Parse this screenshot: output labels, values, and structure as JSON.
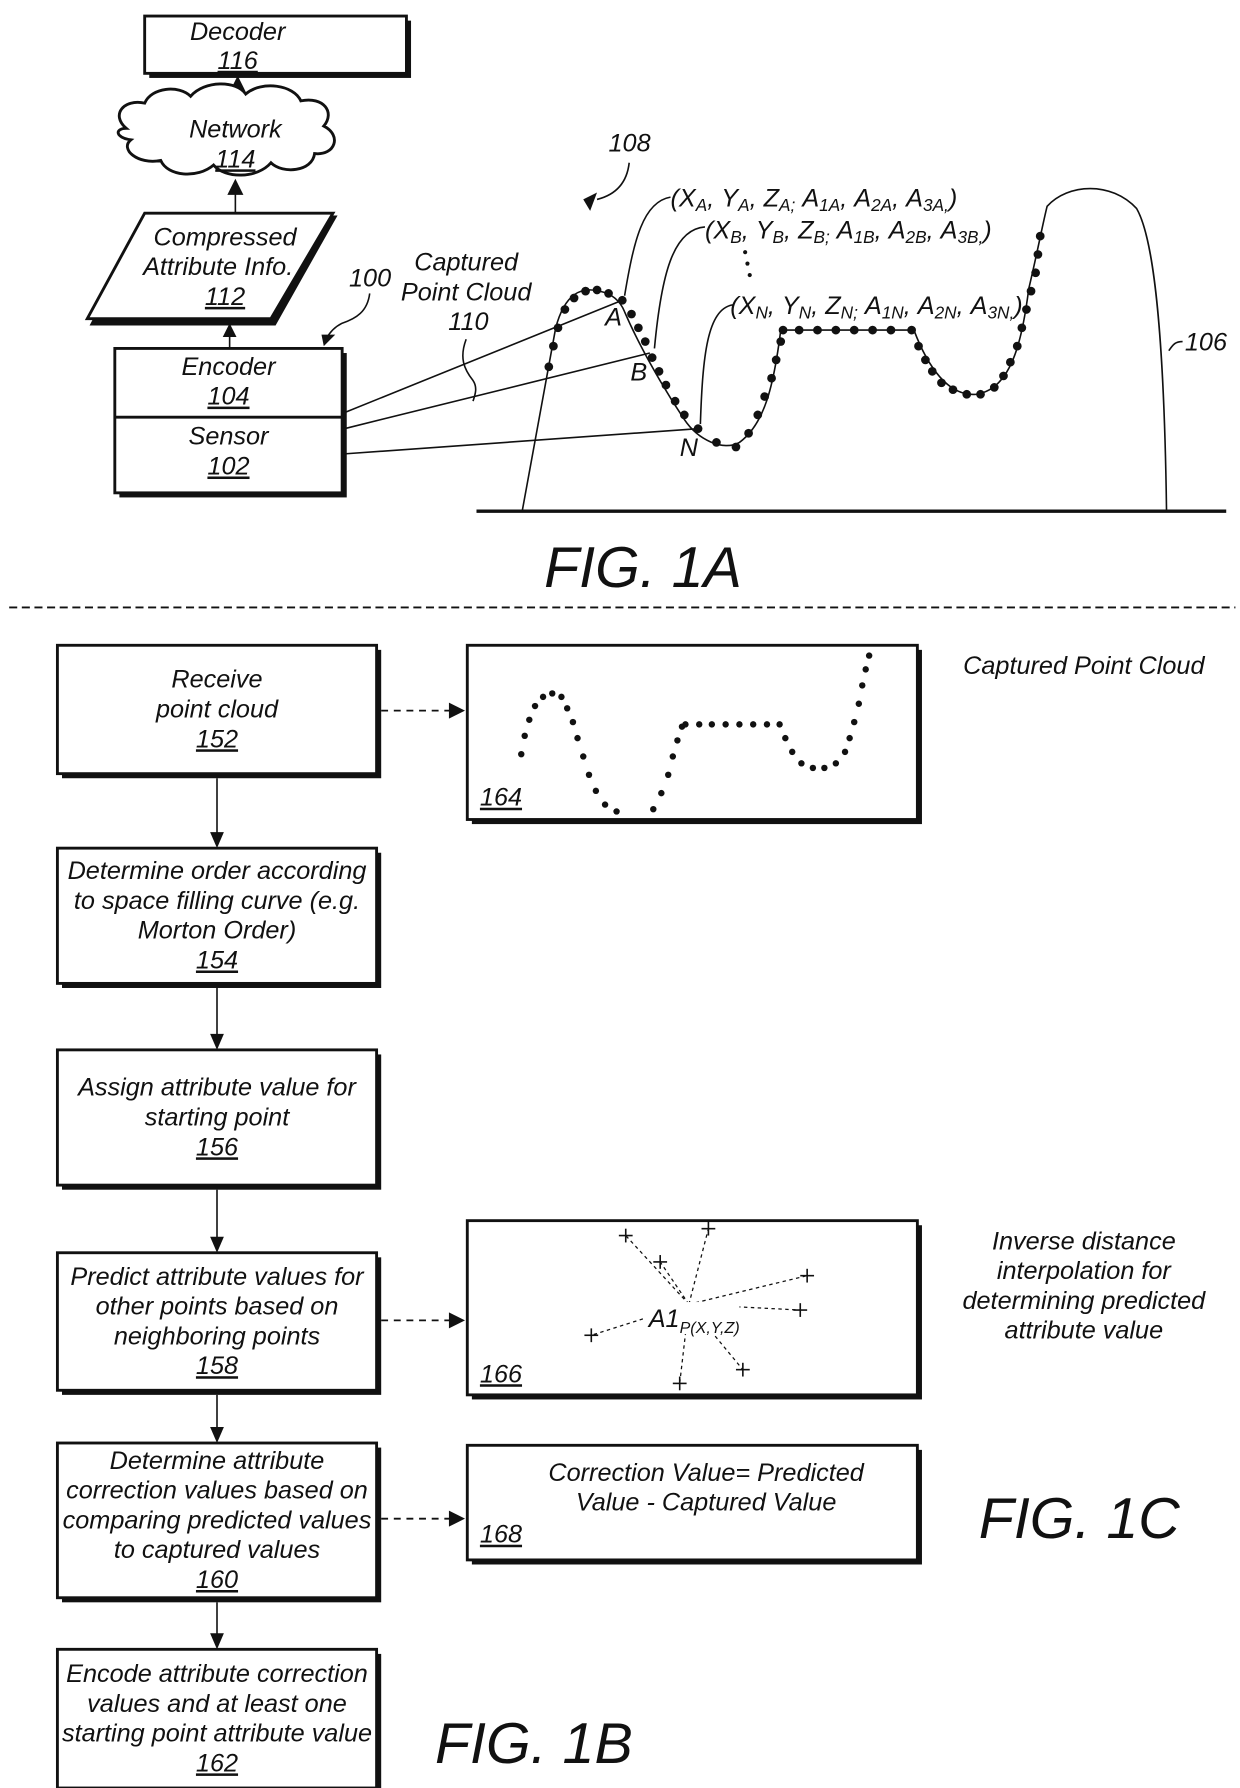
{
  "fig1a": {
    "caption": "FIG. 1A",
    "decoder": {
      "label": "Decoder",
      "ref": "116"
    },
    "network": {
      "label": "Network",
      "ref": "114"
    },
    "compressed": {
      "line1": "Compressed",
      "line2": "Attribute Info.",
      "ref": "112"
    },
    "system_ref": "100",
    "encoder": {
      "label": "Encoder",
      "ref": "104"
    },
    "sensor": {
      "label": "Sensor",
      "ref": "102"
    },
    "captured": {
      "line1": "Captured",
      "line2": "Point Cloud",
      "ref": "110"
    },
    "scene_ref": "108",
    "object_ref": "106",
    "points": {
      "a": "A",
      "b": "B",
      "n": "N"
    },
    "tuples": {
      "a": "(XA, YA, ZA; A1A, A2A, A3A,)",
      "b": "(XB, YB, ZB; A1B, A2B, A3B,)",
      "n": "(XN, YN, ZN; A1N, A2N, A3N,)"
    },
    "tuple_parts": {
      "a": [
        [
          "X",
          "A"
        ],
        [
          "Y",
          "A"
        ],
        [
          "Z",
          "A;"
        ],
        [
          "A",
          "1A"
        ],
        [
          "A",
          "2A"
        ],
        [
          "A",
          "3A,"
        ]
      ],
      "b": [
        [
          "X",
          "B"
        ],
        [
          "Y",
          "B"
        ],
        [
          "Z",
          "B;"
        ],
        [
          "A",
          "1B"
        ],
        [
          "A",
          "2B"
        ],
        [
          "A",
          "3B,"
        ]
      ],
      "n": [
        [
          "X",
          "N"
        ],
        [
          "Y",
          "N"
        ],
        [
          "Z",
          "N;"
        ],
        [
          "A",
          "1N"
        ],
        [
          "A",
          "2N"
        ],
        [
          "A",
          "3N,"
        ]
      ]
    }
  },
  "fig1b": {
    "caption": "FIG. 1B",
    "steps": [
      {
        "lines": [
          "Receive",
          "point cloud"
        ],
        "ref": "152"
      },
      {
        "lines": [
          "Determine order according",
          "to space filling curve (e.g.",
          "Morton Order)"
        ],
        "ref": "154"
      },
      {
        "lines": [
          "Assign attribute value for",
          "starting point"
        ],
        "ref": "156"
      },
      {
        "lines": [
          "Predict attribute values for",
          "other points based on",
          "neighboring points"
        ],
        "ref": "158"
      },
      {
        "lines": [
          "Determine attribute",
          "correction values based on",
          "comparing predicted values",
          "to captured values"
        ],
        "ref": "160"
      },
      {
        "lines": [
          "Encode attribute correction",
          "values and at least one",
          "starting point attribute value"
        ],
        "ref": "162"
      }
    ]
  },
  "fig1c": {
    "caption": "FIG. 1C",
    "panels": [
      {
        "ref": "164",
        "side_label": [
          "Captured Point Cloud"
        ]
      },
      {
        "ref": "166",
        "center_label": "A1",
        "center_sub": "P(X,Y,Z)",
        "side_label": [
          "Inverse distance",
          "interpolation for",
          "determining predicted",
          "attribute value"
        ]
      },
      {
        "ref": "168",
        "lines": [
          "Correction Value= Predicted",
          "Value - Captured Value"
        ]
      }
    ]
  }
}
